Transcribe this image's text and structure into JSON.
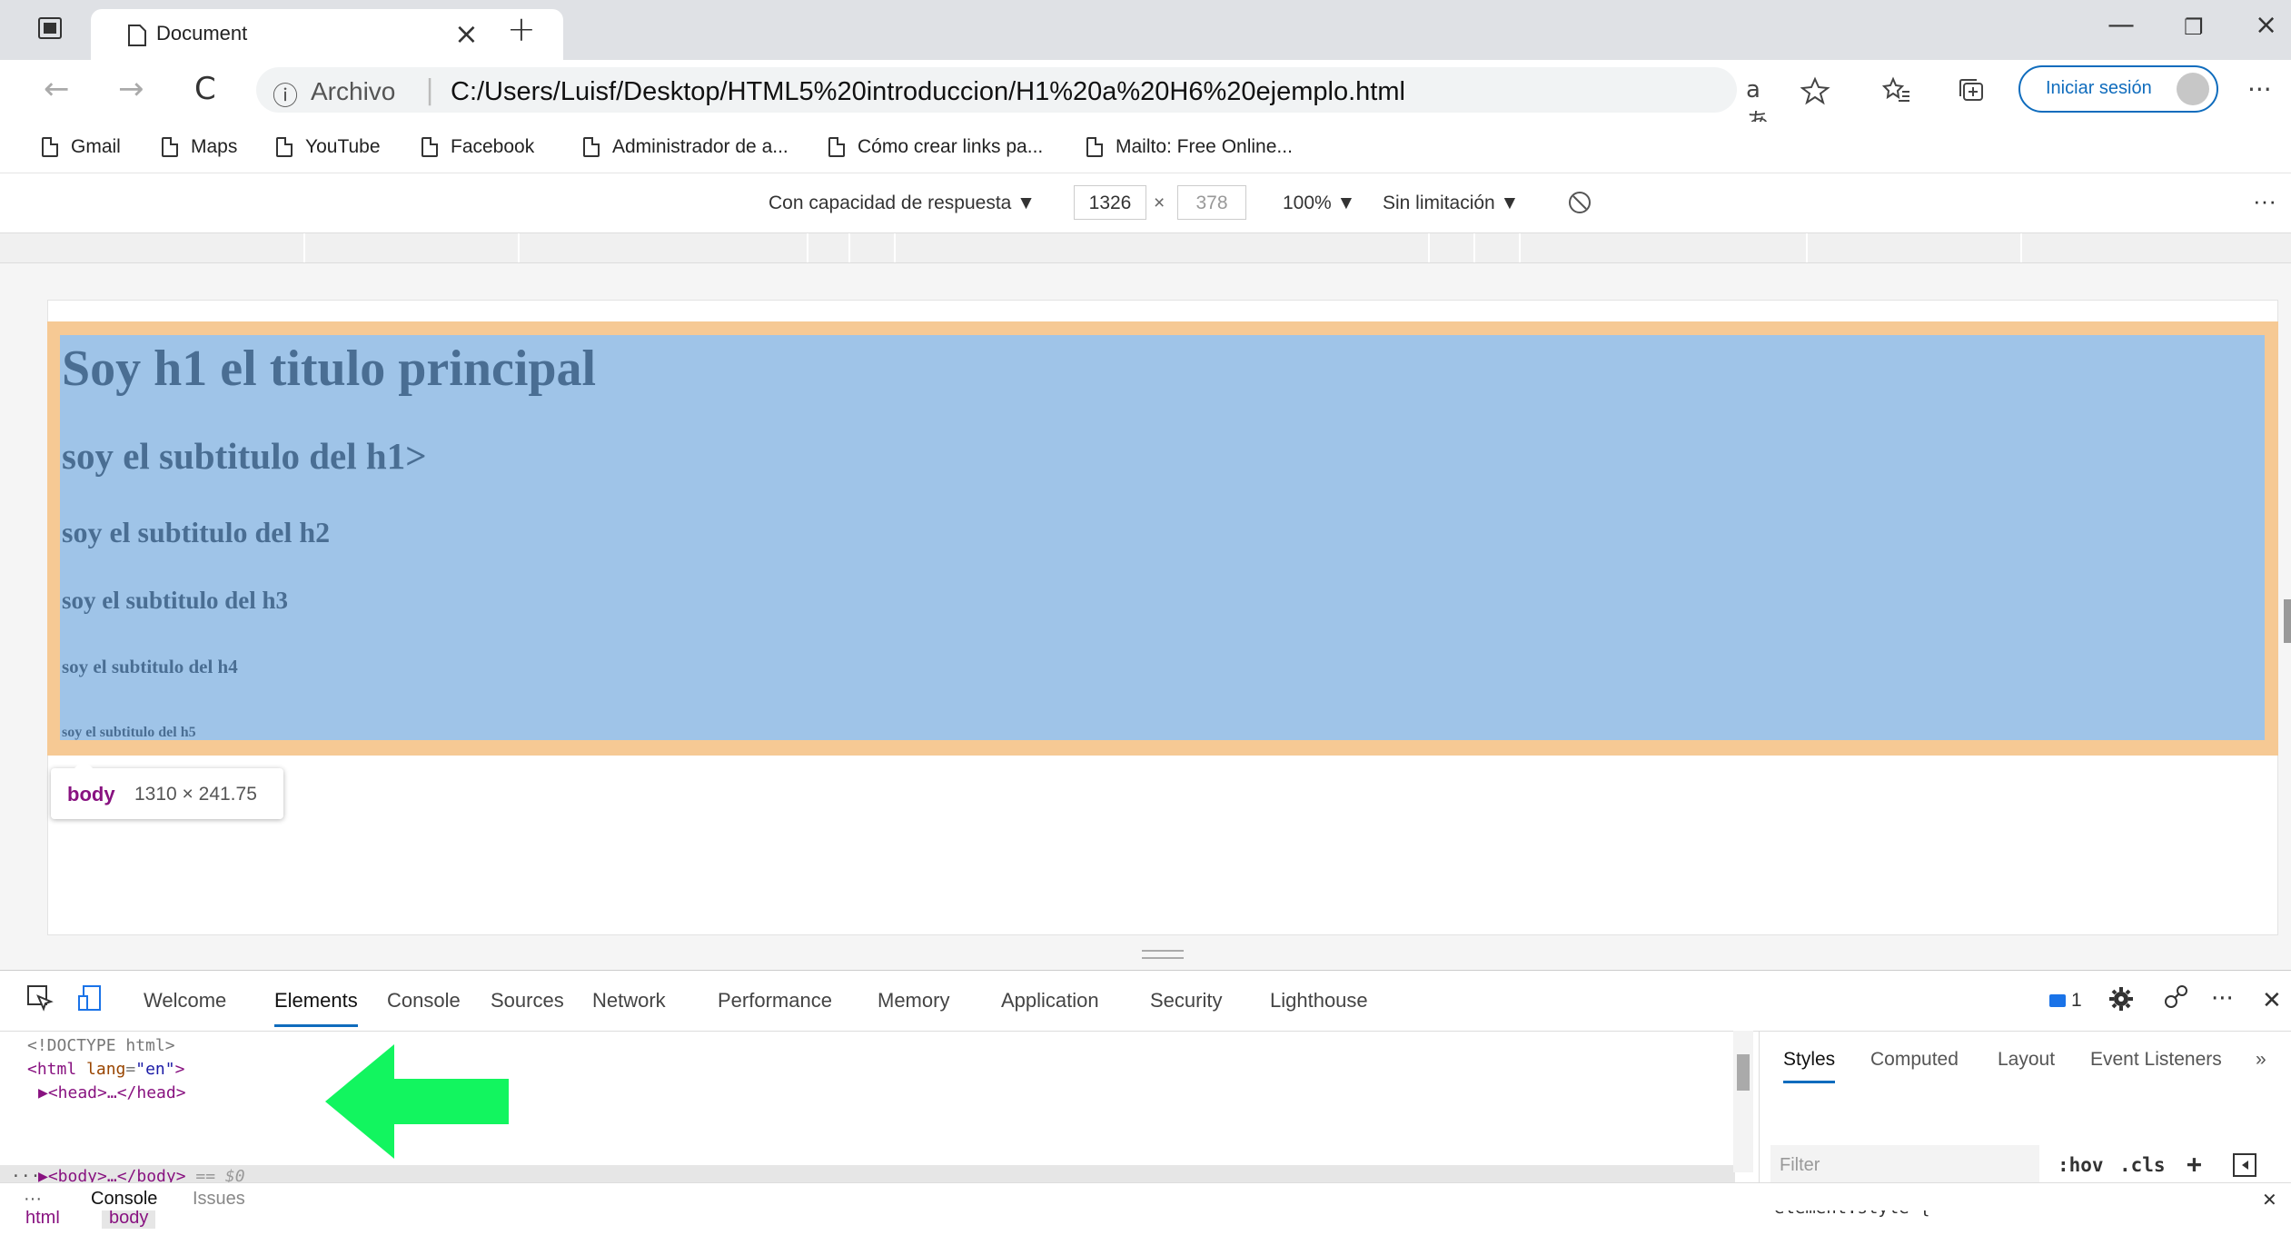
{
  "tab": {
    "title": "Document",
    "close": "×",
    "new": "+"
  },
  "window": {
    "minimize": "—",
    "restore": "❐",
    "close": "×"
  },
  "nav": {
    "back": "←",
    "forward": "→",
    "reload": "C"
  },
  "address": {
    "info": "ⓘ",
    "scheme": "Archivo",
    "separator": "|",
    "url": "C:/Users/Luisf/Desktop/HTML5%20introduccion/H1%20a%20H6%20ejemplo.html",
    "read_aloud": "aあ"
  },
  "toolbar": {
    "signin_label": "Iniciar sesión",
    "more": "···"
  },
  "bookmarks": [
    {
      "label": "Gmail"
    },
    {
      "label": "Maps"
    },
    {
      "label": "YouTube"
    },
    {
      "label": "Facebook"
    },
    {
      "label": "Administrador de a..."
    },
    {
      "label": "Cómo crear links pa..."
    },
    {
      "label": "Mailto: Free Online..."
    }
  ],
  "device_toolbar": {
    "dimensions_mode": "Con capacidad de respuesta ▼",
    "width": "1326",
    "times": "×",
    "height": "378",
    "zoom": "100% ▼",
    "throttle": "Sin limitación ▼",
    "more": "···"
  },
  "page": {
    "h1": "Soy h1 el titulo principal",
    "h2": "soy el subtitulo del h1>",
    "h3": "soy el subtitulo del h2",
    "h4": "soy el subtitulo del h3",
    "h5": "soy el subtitulo del h4",
    "h6": "soy el subtitulo del h5"
  },
  "tooltip": {
    "tag": "body",
    "size": "1310 × 241.75"
  },
  "devtools": {
    "tabs": [
      "Welcome",
      "Elements",
      "Console",
      "Sources",
      "Network",
      "Performance",
      "Memory",
      "Application",
      "Security",
      "Lighthouse"
    ],
    "active_tab": "Elements",
    "issues_count": "1",
    "more": "···",
    "close": "✕",
    "dom": {
      "doctype": "<!DOCTYPE html>",
      "html_open_tag": "<html",
      "html_attr": "lang",
      "html_attr_value": "\"en\"",
      "head": "▶<head>…</head>",
      "body": "▶<body>…</body>",
      "body_ref": "== $0",
      "ellipsis": "···"
    },
    "breadcrumbs": [
      "html",
      "body"
    ],
    "styles_tabs": [
      "Styles",
      "Computed",
      "Layout",
      "Event Listeners"
    ],
    "styles_more": "»",
    "filter_placeholder": "Filter",
    "hov": ":hov",
    "cls": ".cls",
    "plus": "+",
    "rule": "element.style {"
  },
  "drawer": {
    "more": "···",
    "console": "Console",
    "issues": "Issues",
    "close": "✕"
  },
  "colors": {
    "accent": "#0f6cbd",
    "margin_overlay": "#f6c994",
    "content_overlay": "#9fc4e8",
    "arrow": "#12f55f"
  }
}
